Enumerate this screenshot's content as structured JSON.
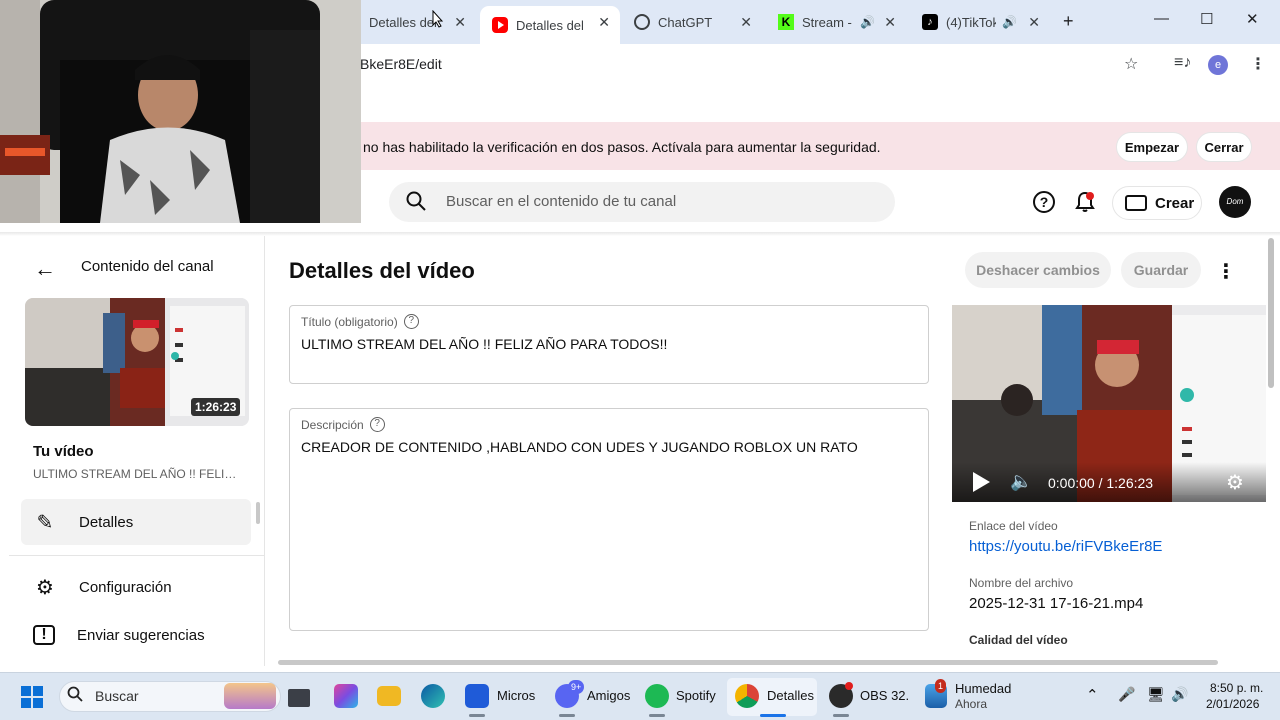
{
  "browser": {
    "tabs": [
      {
        "label": "Detalles del",
        "icon": "youtube-studio-icon"
      },
      {
        "label": "Detalles del v",
        "icon": "youtube-icon",
        "active": true
      },
      {
        "label": "ChatGPT",
        "icon": "chatgpt-icon"
      },
      {
        "label": "Stream - ",
        "icon": "kick-icon",
        "audio": true
      },
      {
        "label": "(4)TikTok",
        "icon": "tiktok-icon",
        "audio": true
      }
    ],
    "close_glyph": "✕",
    "new_tab_glyph": "+",
    "url": "BkeEr8E/edit",
    "profile_initial": "e",
    "window_controls": {
      "minimize": "—",
      "maximize": "☐",
      "close": "✕"
    }
  },
  "banner": {
    "text": "no has habilitado la verificación en dos pasos. Actívala para aumentar la seguridad.",
    "start_label": "Empezar",
    "close_label": "Cerrar",
    "bg_color": "#f8e3e7"
  },
  "header": {
    "search_placeholder": "Buscar en el contenido de tu canal",
    "create_label": "Crear",
    "channel_avatar_text": "Dom"
  },
  "sidebar": {
    "title": "Contenido del canal",
    "thumb_duration": "1:26:23",
    "your_video_label": "Tu vídeo",
    "your_video_title": "ULTIMO STREAM DEL AÑO !! FELIZ AÑO PARA TODOS!!",
    "items": [
      {
        "label": "Detalles",
        "icon": "pencil-icon",
        "selected": true
      },
      {
        "label": "Configuración",
        "icon": "gear-icon"
      },
      {
        "label": "Enviar sugerencias",
        "icon": "feedback-icon"
      }
    ]
  },
  "main": {
    "title": "Detalles del vídeo",
    "undo_label": "Deshacer cambios",
    "save_label": "Guardar",
    "title_field": {
      "label": "Título (obligatorio)",
      "value": "ULTIMO STREAM DEL AÑO !! FELIZ AÑO PARA TODOS!!"
    },
    "description_field": {
      "label": "Descripción",
      "value": "CREADOR DE CONTENIDO ,HABLANDO CON UDES Y JUGANDO ROBLOX UN RATO"
    }
  },
  "preview": {
    "timecode": "0:00:00 / 1:26:23",
    "link_label": "Enlace del vídeo",
    "link": "https://youtu.be/riFVBkeEr8E",
    "filename_label": "Nombre del archivo",
    "filename": "2025-12-31 17-16-21.mp4",
    "quality_label": "Calidad del vídeo"
  },
  "taskbar": {
    "search_text": "Buscar",
    "apps": [
      {
        "label": "Micros",
        "icon": "microsoft-store-icon"
      },
      {
        "label": "Amigos",
        "icon": "discord-icon",
        "badge": "9+"
      },
      {
        "label": "Spotify",
        "icon": "spotify-icon"
      },
      {
        "label": "Detalles",
        "icon": "chrome-icon",
        "active": true
      },
      {
        "label": "OBS 32.",
        "icon": "obs-icon"
      }
    ],
    "weather": {
      "title": "Humedad",
      "subtitle": "Ahora",
      "badge": "1"
    },
    "time": "8:50 p. m.",
    "date": "2/01/2026"
  }
}
